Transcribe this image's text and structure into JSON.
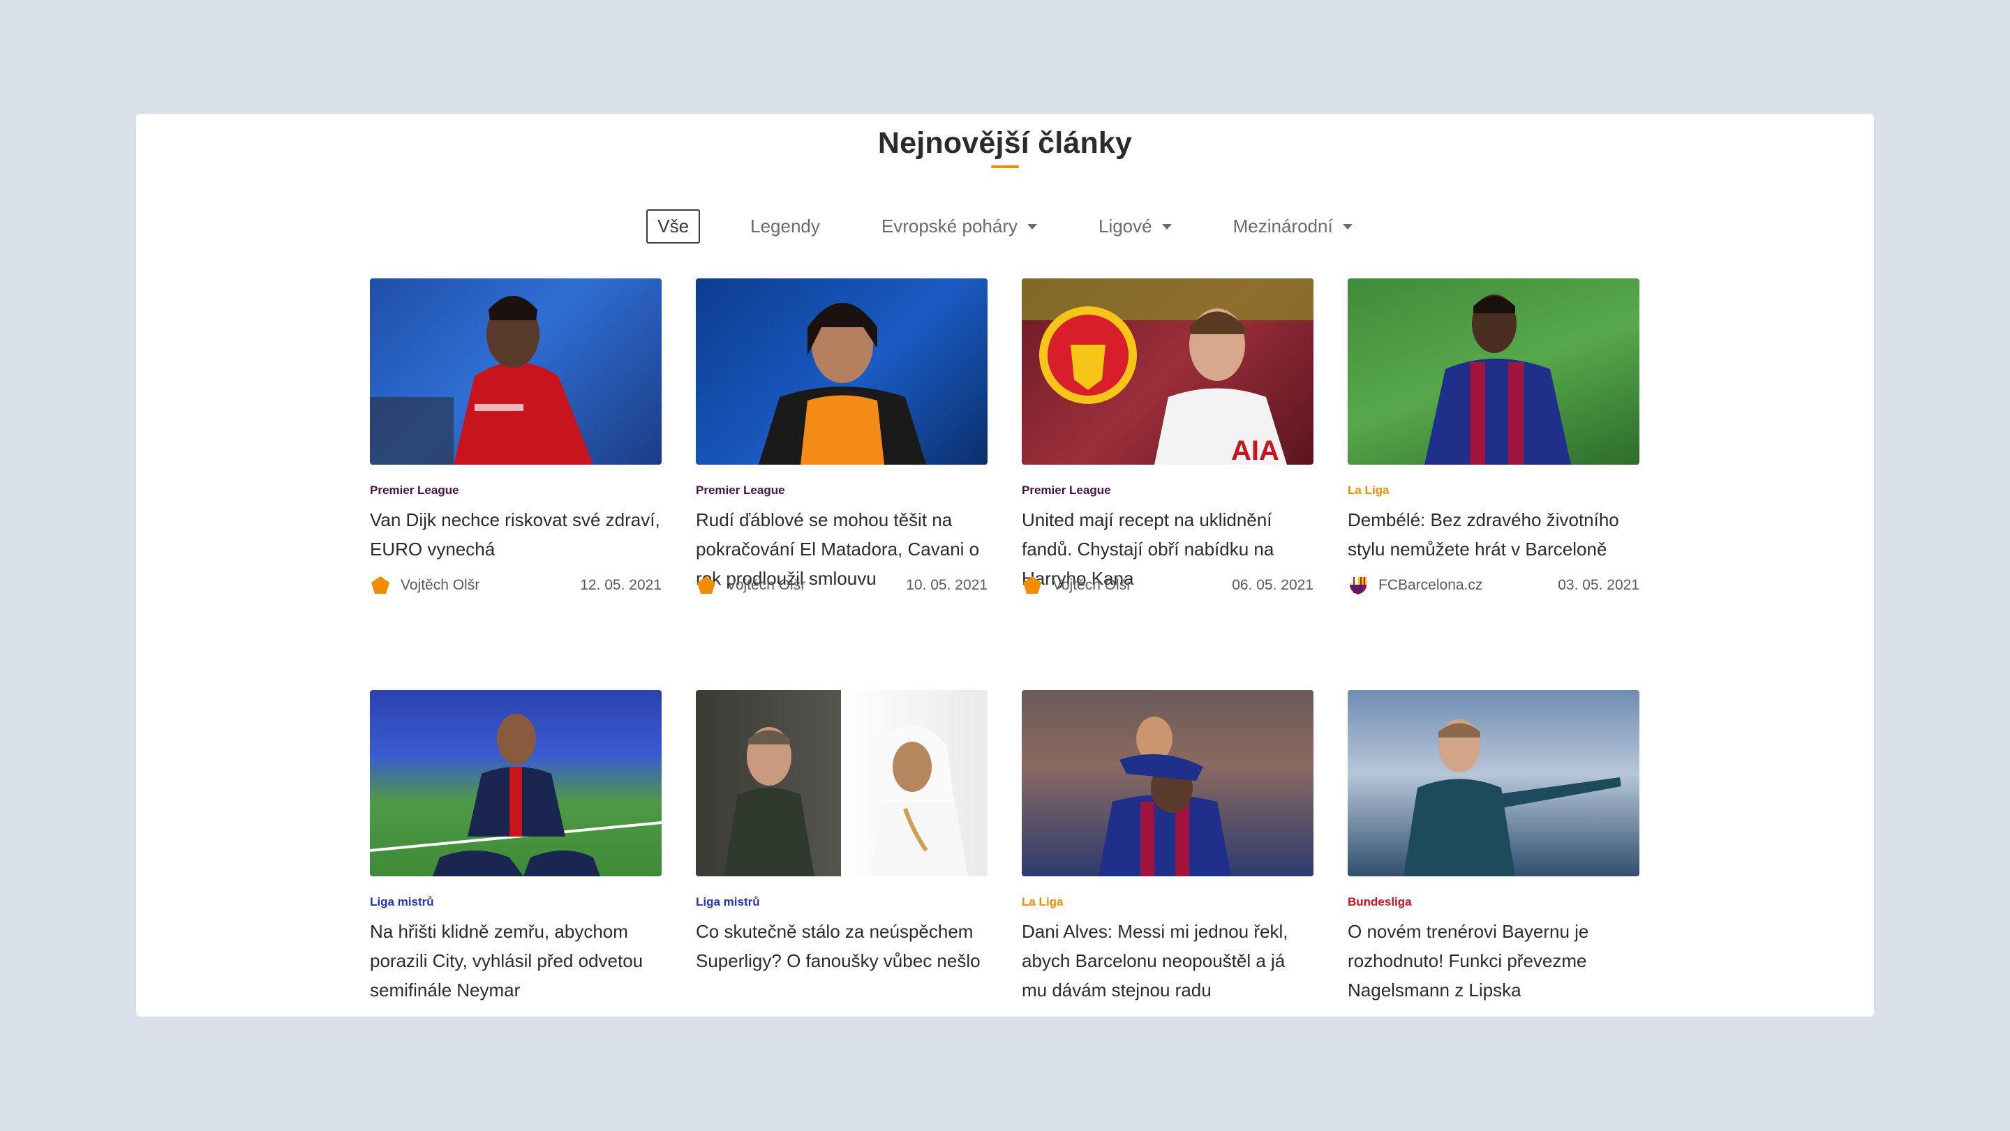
{
  "section": {
    "title": "Nejnovější články"
  },
  "filters": [
    {
      "label": "Vše",
      "active": true,
      "dropdown": false
    },
    {
      "label": "Legendy",
      "active": false,
      "dropdown": false
    },
    {
      "label": "Evropské poháry",
      "active": false,
      "dropdown": true
    },
    {
      "label": "Ligové",
      "active": false,
      "dropdown": true
    },
    {
      "label": "Mezinárodní",
      "active": false,
      "dropdown": true
    }
  ],
  "colors": {
    "accent": "#f28c00",
    "premier_league": "#4a1047",
    "la_liga": "#f28c00",
    "liga_mistru": "#2233bb",
    "bundesliga": "#d2121a"
  },
  "articles": [
    {
      "category": "Premier League",
      "category_color": "#4a1047",
      "title": "Van Dijk nechce riskovat své zdraví, EURO vynechá",
      "author": "Vojtěch Olšr",
      "author_icon": "orange-pentagon-icon",
      "date": "12. 05. 2021",
      "image": "player-red-kit"
    },
    {
      "category": "Premier League",
      "category_color": "#4a1047",
      "title": "Rudí ďáblové se mohou těšit na pokračování El Matadora, Cavani o rok prodloužil smlouvu",
      "author": "Vojtěch Olšr",
      "author_icon": "orange-pentagon-icon",
      "date": "10. 05. 2021",
      "image": "player-orange-bib"
    },
    {
      "category": "Premier League",
      "category_color": "#4a1047",
      "title": "United mají recept na uklidnění fandů. Chystají obří nabídku na Harryho Kana",
      "author": "Vojtěch Olšr",
      "author_icon": "orange-pentagon-icon",
      "date": "06. 05. 2021",
      "image": "manchester-united-crest-and-player"
    },
    {
      "category": "La Liga",
      "category_color": "#f28c00",
      "title": "Dembélé: Bez zdravého životního stylu nemůžete hrát v Barceloně",
      "author": "FCBarcelona.cz",
      "author_icon": "fcb-crest-icon",
      "date": "03. 05. 2021",
      "image": "player-barcelona-kit"
    },
    {
      "category": "Liga mistrů",
      "category_color": "#2233bb",
      "title": "Na hřišti klidně zemřu, abychom porazili City, vyhlásil před odvetou semifinále Neymar",
      "author": "",
      "author_icon": "",
      "date": "",
      "image": "player-psg-kit-sitting"
    },
    {
      "category": "Liga mistrů",
      "category_color": "#2233bb",
      "title": "Co skutečně stálo za neúspěchem Superligy? O fanoušky vůbec nešlo",
      "author": "",
      "author_icon": "",
      "date": "",
      "image": "two-club-owners"
    },
    {
      "category": "La Liga",
      "category_color": "#f28c00",
      "title": "Dani Alves: Messi mi jednou řekl, abych Barcelonu neopouštěl a já mu dávám stejnou radu",
      "author": "",
      "author_icon": "",
      "date": "",
      "image": "players-celebrating"
    },
    {
      "category": "Bundesliga",
      "category_color": "#d2121a",
      "title": "O novém trenérovi Bayernu je rozhodnuto! Funkci převezme Nagelsmann z Lipska",
      "author": "",
      "author_icon": "",
      "date": "",
      "image": "coach-pointing"
    }
  ]
}
